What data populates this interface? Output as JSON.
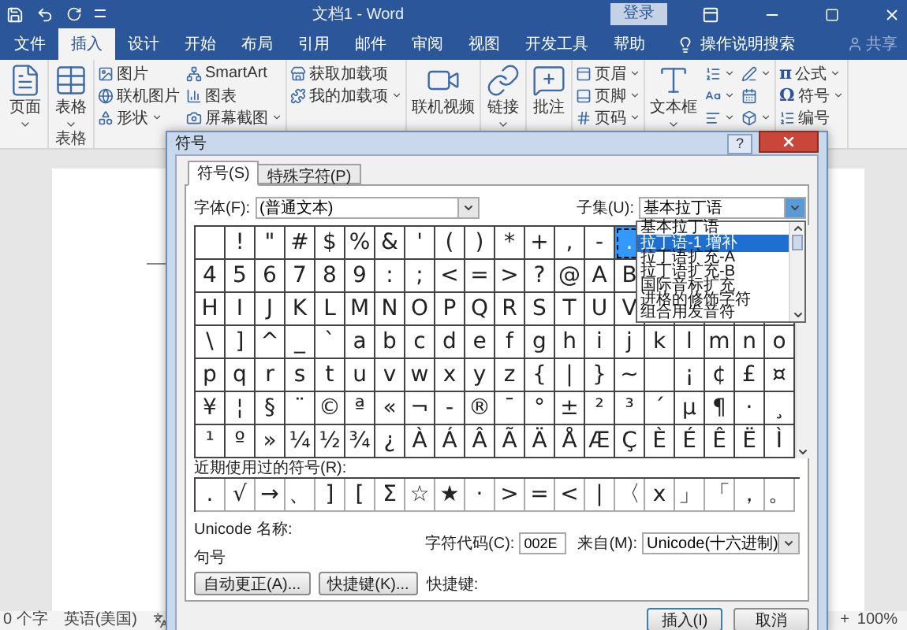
{
  "title_bar": {
    "title": "文档1 - Word",
    "login": "登录"
  },
  "tabs": [
    {
      "label": "文件",
      "selected": false
    },
    {
      "label": "插入",
      "selected": true
    },
    {
      "label": "设计",
      "selected": false
    },
    {
      "label": "开始",
      "selected": false
    },
    {
      "label": "布局",
      "selected": false
    },
    {
      "label": "引用",
      "selected": false
    },
    {
      "label": "邮件",
      "selected": false
    },
    {
      "label": "审阅",
      "selected": false
    },
    {
      "label": "视图",
      "selected": false
    },
    {
      "label": "开发工具",
      "selected": false
    },
    {
      "label": "帮助",
      "selected": false
    }
  ],
  "tell_me": "操作说明搜索",
  "share": "共享",
  "ribbon_groups": [
    {
      "columns": [
        [
          {
            "kind": "large",
            "label": "页面",
            "caret": true
          }
        ]
      ]
    },
    {
      "label": "表格",
      "columns": [
        [
          {
            "kind": "large",
            "label": "表格",
            "caret": true
          }
        ]
      ]
    },
    {
      "columns": [
        [
          {
            "kind": "small",
            "label": "图片",
            "caret": false
          },
          {
            "kind": "small",
            "label": "联机图片",
            "caret": false
          },
          {
            "kind": "small",
            "label": "形状",
            "caret": true
          }
        ],
        [
          {
            "kind": "small",
            "label": "SmartArt",
            "caret": false
          },
          {
            "kind": "small",
            "label": "图表",
            "caret": false
          },
          {
            "kind": "small",
            "label": "屏幕截图",
            "caret": true
          }
        ]
      ]
    },
    {
      "columns": [
        [
          {
            "kind": "small",
            "label": "获取加载项",
            "caret": false
          },
          {
            "kind": "small",
            "label": "我的加载项",
            "caret": true
          }
        ]
      ]
    },
    {
      "columns": [
        [
          {
            "kind": "large",
            "label": "联机视频",
            "caret": false
          }
        ]
      ]
    },
    {
      "columns": [
        [
          {
            "kind": "large",
            "label": "链接",
            "caret": true
          }
        ]
      ]
    },
    {
      "columns": [
        [
          {
            "kind": "large",
            "label": "批注",
            "caret": false
          }
        ]
      ]
    },
    {
      "columns": [
        [
          {
            "kind": "small",
            "label": "页眉",
            "caret": true
          },
          {
            "kind": "small",
            "label": "页脚",
            "caret": true
          },
          {
            "kind": "small",
            "label": "页码",
            "caret": true
          }
        ]
      ]
    },
    {
      "columns": [
        [
          {
            "kind": "large",
            "label": "文本框",
            "caret": true
          }
        ],
        [
          {
            "kind": "small",
            "caret": true
          },
          {
            "kind": "small",
            "caret": true
          },
          {
            "kind": "small",
            "caret": true
          }
        ],
        [
          {
            "kind": "small",
            "caret": true
          },
          {
            "kind": "small",
            "caret": false
          },
          {
            "kind": "small",
            "caret": true
          }
        ]
      ]
    },
    {
      "columns": [
        [
          {
            "kind": "small",
            "glyph": "π",
            "label": "公式",
            "caret": true
          },
          {
            "kind": "small",
            "glyph": "Ω",
            "label": "符号",
            "caret": true
          },
          {
            "kind": "small",
            "label": "编号",
            "caret": false
          }
        ]
      ]
    }
  ],
  "status_bar": {
    "words": "0 个字",
    "language": "英语(美国)",
    "zoom_plus": "+",
    "zoom": "100%"
  },
  "dialog": {
    "title": "符号",
    "help": "?",
    "tabs": [
      {
        "label": "符号(S)",
        "selected": true
      },
      {
        "label": "特殊字符(P)",
        "selected": false
      }
    ],
    "font_label": "字体(F):",
    "font_value": "(普通文本)",
    "subset_label": "子集(U):",
    "subset_value": "基本拉丁语",
    "subset_options": [
      {
        "label": "基本拉丁语",
        "selected": false
      },
      {
        "label": "拉丁语-1 增补",
        "selected": true
      },
      {
        "label": "拉丁语扩充-A",
        "selected": false
      },
      {
        "label": "拉丁语扩充-B",
        "selected": false
      },
      {
        "label": "国际音标扩充",
        "selected": false
      },
      {
        "label": "进格的修饰字符",
        "selected": false
      },
      {
        "label": "组合用发音符",
        "selected": false
      }
    ],
    "grid": [
      [
        {
          "selected": false
        },
        {
          "char": "!",
          "selected": false
        },
        {
          "char": "\"",
          "selected": false
        },
        {
          "char": "#",
          "selected": false
        },
        {
          "char": "$",
          "selected": false
        },
        {
          "char": "%",
          "selected": false
        },
        {
          "char": "&",
          "selected": false
        },
        {
          "char": "'",
          "selected": false
        },
        {
          "char": "(",
          "selected": false
        },
        {
          "char": ")",
          "selected": false
        },
        {
          "char": "*",
          "selected": false
        },
        {
          "char": "+",
          "selected": false
        },
        {
          "char": ",",
          "selected": false
        },
        {
          "char": "-",
          "selected": false
        },
        {
          "char": ".",
          "selected": true
        }
      ],
      [
        {
          "char": "4",
          "selected": false
        },
        {
          "char": "5",
          "selected": false
        },
        {
          "char": "6",
          "selected": false
        },
        {
          "char": "7",
          "selected": false
        },
        {
          "char": "8",
          "selected": false
        },
        {
          "char": "9",
          "selected": false
        },
        {
          "char": ":",
          "selected": false
        },
        {
          "char": ";",
          "selected": false
        },
        {
          "char": "<",
          "selected": false
        },
        {
          "char": "=",
          "selected": false
        },
        {
          "char": ">",
          "selected": false
        },
        {
          "char": "?",
          "selected": false
        },
        {
          "char": "@",
          "selected": false
        },
        {
          "char": "A",
          "selected": false
        },
        {
          "char": "B",
          "selected": false
        }
      ],
      [
        {
          "char": "H",
          "selected": false
        },
        {
          "char": "I",
          "selected": false
        },
        {
          "char": "J",
          "selected": false
        },
        {
          "char": "K",
          "selected": false
        },
        {
          "char": "L",
          "selected": false
        },
        {
          "char": "M",
          "selected": false
        },
        {
          "char": "N",
          "selected": false
        },
        {
          "char": "O",
          "selected": false
        },
        {
          "char": "P",
          "selected": false
        },
        {
          "char": "Q",
          "selected": false
        },
        {
          "char": "R",
          "selected": false
        },
        {
          "char": "S",
          "selected": false
        },
        {
          "char": "T",
          "selected": false
        },
        {
          "char": "U",
          "selected": false
        },
        {
          "char": "V",
          "selected": false
        }
      ],
      [
        {
          "char": "\\",
          "selected": false
        },
        {
          "char": "]",
          "selected": false
        },
        {
          "char": "^",
          "selected": false
        },
        {
          "char": "_",
          "selected": false
        },
        {
          "char": "`",
          "selected": false
        },
        {
          "char": "a",
          "selected": false
        },
        {
          "char": "b",
          "selected": false
        },
        {
          "char": "c",
          "selected": false
        },
        {
          "char": "d",
          "selected": false
        },
        {
          "char": "e",
          "selected": false
        },
        {
          "char": "f",
          "selected": false
        },
        {
          "char": "g",
          "selected": false
        },
        {
          "char": "h",
          "selected": false
        },
        {
          "char": "i",
          "selected": false
        },
        {
          "char": "j",
          "selected": false
        },
        {
          "char": "k",
          "selected": false
        },
        {
          "char": "l",
          "selected": false
        },
        {
          "char": "m",
          "selected": false
        },
        {
          "char": "n",
          "selected": false
        },
        {
          "char": "o",
          "selected": false
        }
      ],
      [
        {
          "char": "p",
          "selected": false
        },
        {
          "char": "q",
          "selected": false
        },
        {
          "char": "r",
          "selected": false
        },
        {
          "char": "s",
          "selected": false
        },
        {
          "char": "t",
          "selected": false
        },
        {
          "char": "u",
          "selected": false
        },
        {
          "char": "v",
          "selected": false
        },
        {
          "char": "w",
          "selected": false
        },
        {
          "char": "x",
          "selected": false
        },
        {
          "char": "y",
          "selected": false
        },
        {
          "char": "z",
          "selected": false
        },
        {
          "char": "{",
          "selected": false
        },
        {
          "char": "|",
          "selected": false
        },
        {
          "char": "}",
          "selected": false
        },
        {
          "char": "~",
          "selected": false
        },
        {
          "selected": false
        },
        {
          "char": "¡",
          "selected": false
        },
        {
          "char": "¢",
          "selected": false
        },
        {
          "char": "£",
          "selected": false
        },
        {
          "char": "¤",
          "selected": false
        }
      ],
      [
        {
          "char": "¥",
          "selected": false
        },
        {
          "char": "¦",
          "selected": false
        },
        {
          "char": "§",
          "selected": false
        },
        {
          "char": "¨",
          "selected": false
        },
        {
          "char": "©",
          "selected": false
        },
        {
          "char": "ª",
          "selected": false
        },
        {
          "char": "«",
          "selected": false
        },
        {
          "char": "¬",
          "selected": false
        },
        {
          "char": "-",
          "selected": false
        },
        {
          "char": "®",
          "selected": false
        },
        {
          "char": "¯",
          "selected": false
        },
        {
          "char": "°",
          "selected": false
        },
        {
          "char": "±",
          "selected": false
        },
        {
          "char": "²",
          "selected": false
        },
        {
          "char": "³",
          "selected": false
        },
        {
          "char": "´",
          "selected": false
        },
        {
          "char": "µ",
          "selected": false
        },
        {
          "char": "¶",
          "selected": false
        },
        {
          "char": "·",
          "selected": false
        },
        {
          "char": "¸",
          "selected": false
        }
      ],
      [
        {
          "char": "¹",
          "selected": false
        },
        {
          "char": "º",
          "selected": false
        },
        {
          "char": "»",
          "selected": false
        },
        {
          "char": "¼",
          "selected": false
        },
        {
          "char": "½",
          "selected": false
        },
        {
          "char": "¾",
          "selected": false
        },
        {
          "char": "¿",
          "selected": false
        },
        {
          "char": "À",
          "selected": false
        },
        {
          "char": "Á",
          "selected": false
        },
        {
          "char": "Â",
          "selected": false
        },
        {
          "char": "Ã",
          "selected": false
        },
        {
          "char": "Ä",
          "selected": false
        },
        {
          "char": "Å",
          "selected": false
        },
        {
          "char": "Æ",
          "selected": false
        },
        {
          "char": "Ç",
          "selected": false
        },
        {
          "char": "È",
          "selected": false
        },
        {
          "char": "É",
          "selected": false
        },
        {
          "char": "Ê",
          "selected": false
        },
        {
          "char": "Ë",
          "selected": false
        },
        {
          "char": "Ì",
          "selected": false
        }
      ]
    ],
    "recent_label": "近期使用过的符号(R):",
    "recent": [
      ".",
      "√",
      "→",
      "、",
      "]",
      "[",
      "Σ",
      "☆",
      "★",
      "·",
      ">",
      "=",
      "<",
      "|",
      "〈",
      "x",
      "」",
      "「",
      "，",
      "。"
    ],
    "unicode_name_label": "Unicode 名称:",
    "unicode_name": "句号",
    "code_label": "字符代码(C):",
    "code_value": "002E",
    "from_label": "来自(M):",
    "from_value": "Unicode(十六进制)",
    "buttons": [
      "自动更正(A)...",
      "快捷键(K)..."
    ],
    "shortcut_label": "快捷键:",
    "actions": [
      {
        "label": "插入(I)",
        "default": true
      },
      {
        "label": "取消",
        "default": false
      }
    ]
  }
}
